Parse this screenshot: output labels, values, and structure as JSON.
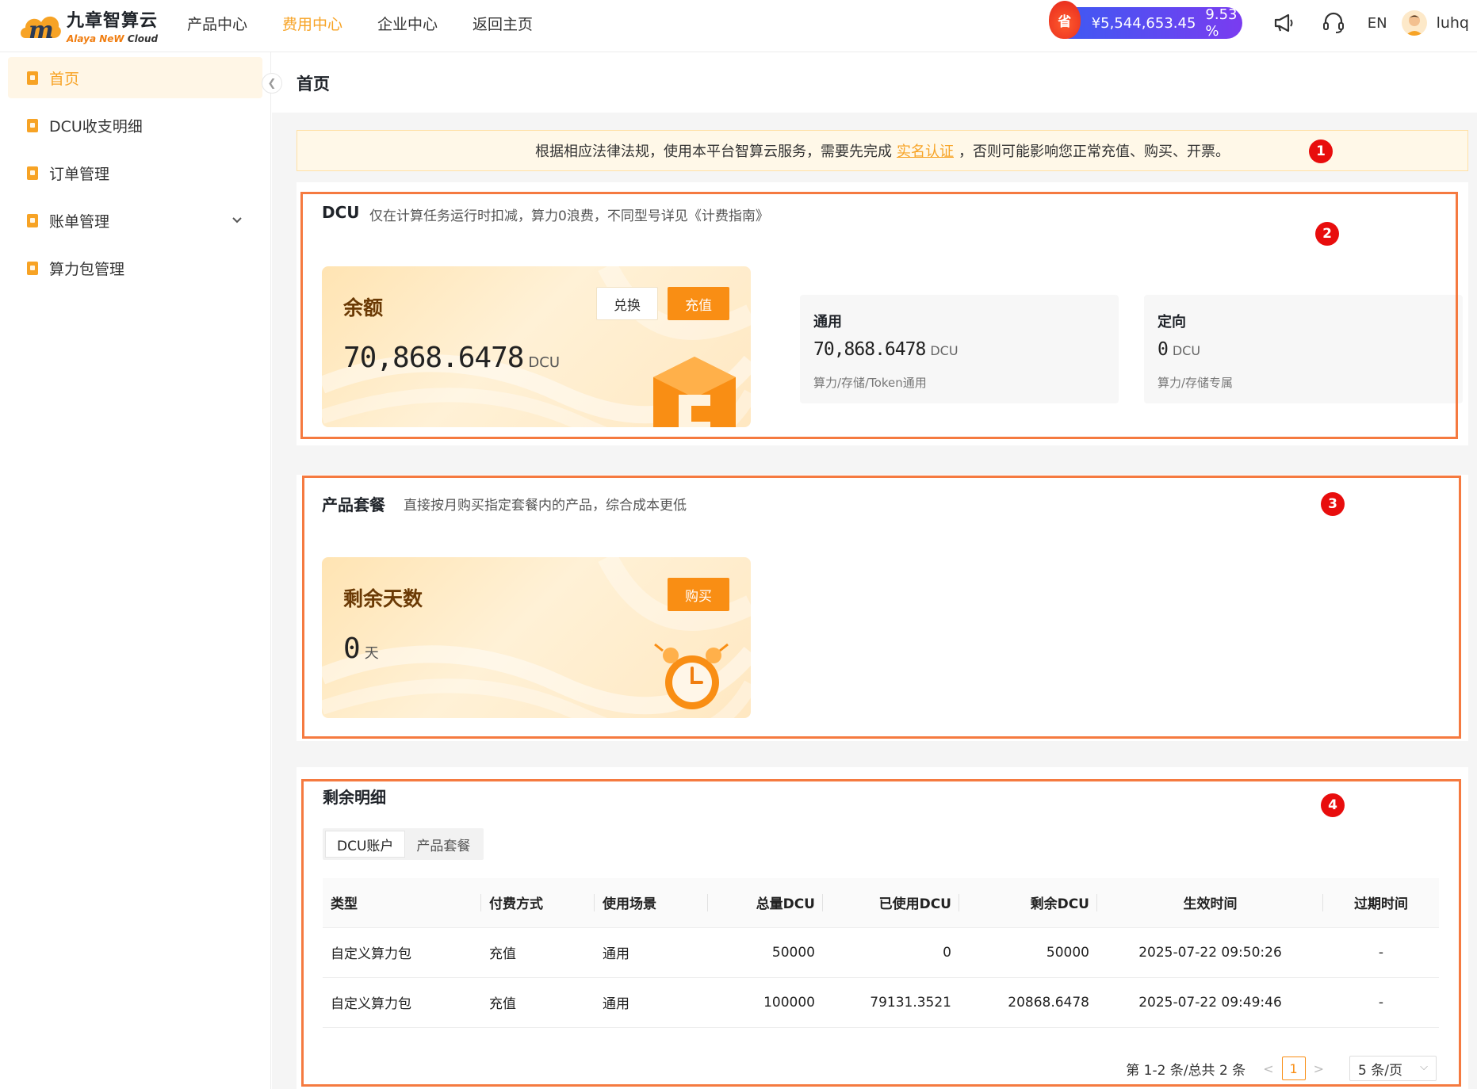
{
  "header": {
    "logo_cn": "九章智算云",
    "logo_en_a": "Alaya NeW",
    "logo_en_b": "Cloud",
    "nav": [
      "产品中心",
      "费用中心",
      "企业中心",
      "返回主页"
    ],
    "active_nav": "费用中心",
    "savings_badge": "省",
    "savings_amount": "¥5,544,653.45",
    "savings_pct": "9.53 %",
    "icons": [
      "megaphone-icon",
      "headset-icon"
    ],
    "lang": "EN",
    "username": "luhq"
  },
  "sidebar": {
    "items": [
      {
        "label": "首页",
        "active": true
      },
      {
        "label": "DCU收支明细"
      },
      {
        "label": "订单管理"
      },
      {
        "label": "账单管理",
        "expandable": true
      },
      {
        "label": "算力包管理"
      }
    ]
  },
  "page": {
    "title": "首页",
    "notice_pre": "根据相应法律法规，使用本平台智算云服务，需要先完成",
    "notice_link": "实名认证",
    "notice_post": "，否则可能影响您正常充值、购买、开票。"
  },
  "annotations": [
    "1",
    "2",
    "3",
    "4"
  ],
  "dcu": {
    "title": "DCU",
    "desc": "仅在计算任务运行时扣减，算力0浪费，不同型号详见《计费指南》",
    "balance_label": "余额",
    "balance_value": "70,868.6478",
    "balance_unit": "DCU",
    "exchange_btn": "兑换",
    "recharge_btn": "充值",
    "general": {
      "title": "通用",
      "value": "70,868.6478",
      "unit": "DCU",
      "desc": "算力/存储/Token通用"
    },
    "directed": {
      "title": "定向",
      "value": "0",
      "unit": "DCU",
      "desc": "算力/存储专属"
    }
  },
  "package": {
    "title": "产品套餐",
    "desc": "直接按月购买指定套餐内的产品，综合成本更低",
    "days_label": "剩余天数",
    "days_value": "0",
    "days_unit": "天",
    "buy_btn": "购买"
  },
  "detail": {
    "title": "剩余明细",
    "tabs": [
      "DCU账户",
      "产品套餐"
    ],
    "columns": [
      "类型",
      "付费方式",
      "使用场景",
      "总量DCU",
      "已使用DCU",
      "剩余DCU",
      "生效时间",
      "过期时间"
    ],
    "rows": [
      [
        "自定义算力包",
        "充值",
        "通用",
        "50000",
        "0",
        "50000",
        "2025-07-22 09:50:26",
        "-"
      ],
      [
        "自定义算力包",
        "充值",
        "通用",
        "100000",
        "79131.3521",
        "20868.6478",
        "2025-07-22 09:49:46",
        "-"
      ]
    ],
    "pager_summary": "第 1-2 条/总共 2 条",
    "prev": "<",
    "current_page": "1",
    "next": ">",
    "page_size": "5 条/页"
  }
}
